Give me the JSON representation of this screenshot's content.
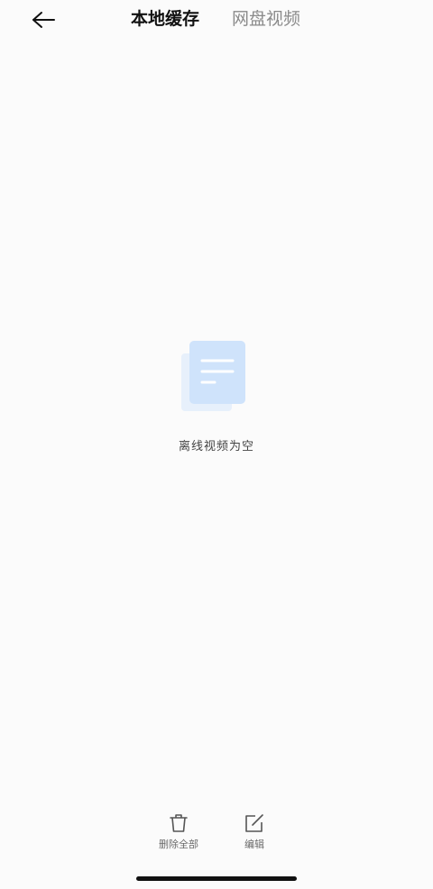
{
  "header": {
    "tabs": [
      {
        "label": "本地缓存"
      },
      {
        "label": "网盘视频"
      }
    ]
  },
  "empty_state": {
    "message": "离线视频为空"
  },
  "bottom_bar": {
    "delete_all_label": "删除全部",
    "edit_label": "编辑"
  },
  "colors": {
    "active_tab": "#111111",
    "inactive_tab": "#8a8a8a",
    "doc_icon_front": "#cfe3fb",
    "doc_icon_back": "#e7f0fb"
  }
}
